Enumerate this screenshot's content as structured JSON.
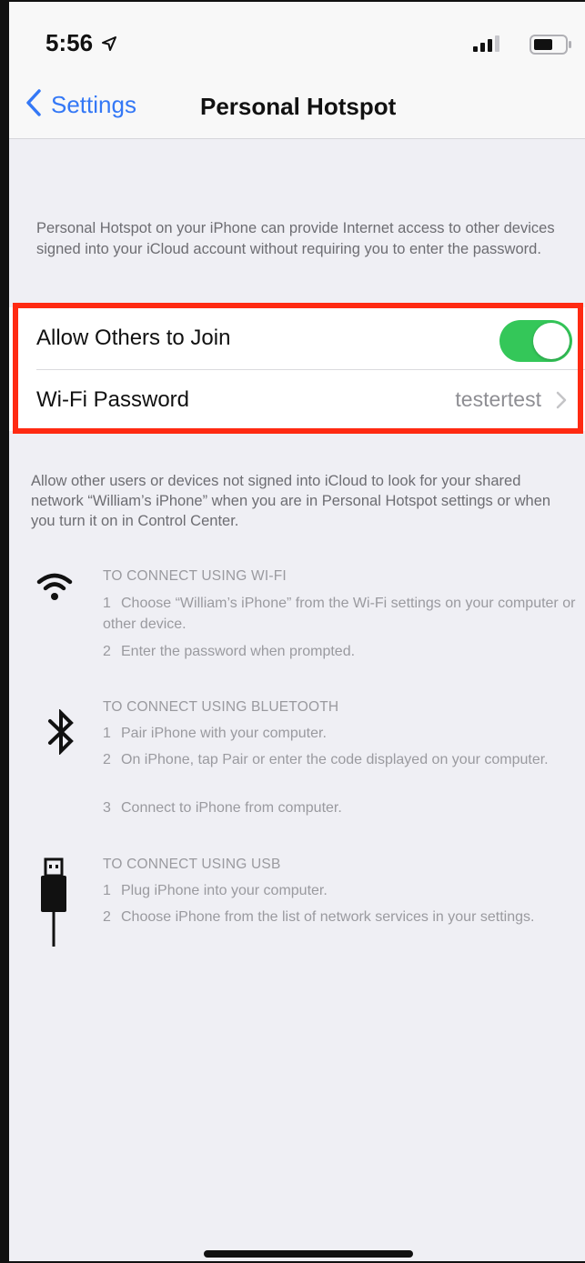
{
  "status_bar": {
    "time": "5:56"
  },
  "nav": {
    "back_label": "Settings",
    "title": "Personal Hotspot"
  },
  "intro_text": "Personal Hotspot on your iPhone can provide Internet access to other devices signed into your iCloud account without requiring you to enter the password.",
  "settings": {
    "allow_label": "Allow Others to Join",
    "allow_enabled": true,
    "wifi_password_label": "Wi-Fi Password",
    "wifi_password_value": "testertest"
  },
  "allow_description": "Allow other users or devices not signed into iCloud to look for your shared network “William’s iPhone” when you are in Personal Hotspot settings or when you turn it on in Control Center.",
  "connect_sections": [
    {
      "icon": "wifi-icon",
      "heading": "TO CONNECT USING WI-FI",
      "steps": [
        {
          "num": "1",
          "text": "Choose “William’s iPhone” from the Wi-Fi settings on your computer or other device."
        },
        {
          "num": "2",
          "text": "Enter the password when prompted."
        }
      ]
    },
    {
      "icon": "bluetooth-icon",
      "heading": "TO CONNECT USING BLUETOOTH",
      "steps": [
        {
          "num": "1",
          "text": "Pair iPhone with your computer."
        },
        {
          "num": "2",
          "text": "On iPhone, tap Pair or enter the code displayed on your computer."
        },
        {
          "num": "3",
          "text": "Connect to iPhone from computer."
        }
      ]
    },
    {
      "icon": "usb-icon",
      "heading": "TO CONNECT USING USB",
      "steps": [
        {
          "num": "1",
          "text": "Plug iPhone into your computer."
        },
        {
          "num": "2",
          "text": "Choose iPhone from the list of network services in your settings."
        }
      ]
    }
  ],
  "colors": {
    "accent": "#3478f6",
    "toggle_on": "#34c759",
    "highlight": "#ff2a12",
    "background": "#efeff4"
  }
}
